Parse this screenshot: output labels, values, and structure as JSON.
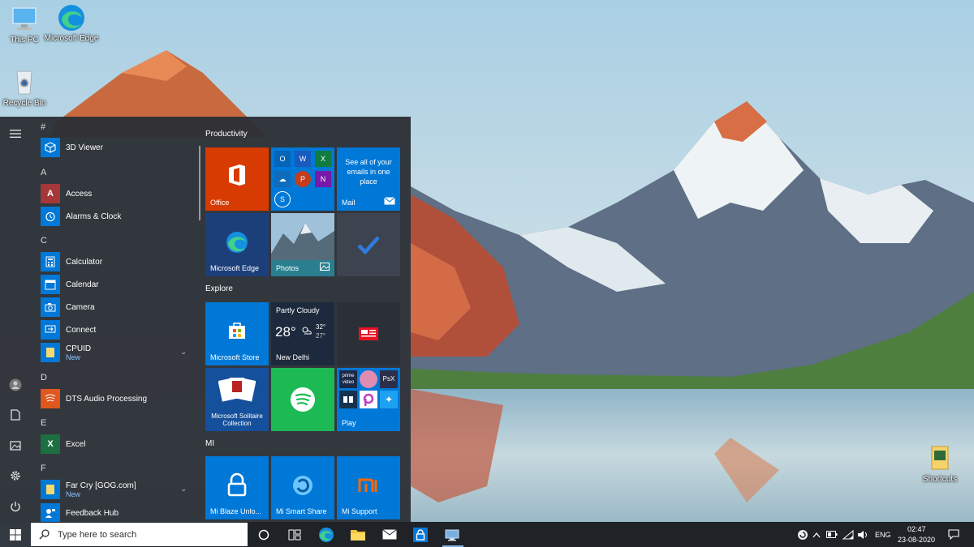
{
  "desktop": {
    "icons": [
      {
        "label": "This PC"
      },
      {
        "label": "Microsoft Edge"
      },
      {
        "label": "Recycle Bin"
      },
      {
        "label": "Shortcuts"
      }
    ]
  },
  "start_menu": {
    "rail": {
      "menu_icon": "hamburger-icon",
      "user_icon": "user-icon",
      "documents_icon": "document-icon",
      "pictures_icon": "pictures-icon",
      "settings_icon": "gear-icon",
      "power_icon": "power-icon"
    },
    "app_list": {
      "groups": {
        "hash": "#",
        "a": "A",
        "c": "C",
        "d": "D",
        "e": "E",
        "f": "F"
      },
      "apps": {
        "viewer3d": "3D Viewer",
        "access": "Access",
        "alarms": "Alarms & Clock",
        "calculator": "Calculator",
        "calendar": "Calendar",
        "camera": "Camera",
        "connect": "Connect",
        "cpuid": "CPUID",
        "cpuid_sub": "New",
        "dts": "DTS Audio Processing",
        "excel": "Excel",
        "farcry": "Far Cry [GOG.com]",
        "farcry_sub": "New",
        "feedback": "Feedback Hub"
      }
    },
    "tiles": {
      "groups": {
        "productivity": "Productivity",
        "explore": "Explore",
        "mi": "MI"
      },
      "office": "Office",
      "mail_text": "See all of your emails in one place",
      "mail": "Mail",
      "edge": "Microsoft Edge",
      "photos": "Photos",
      "store": "Microsoft Store",
      "weather": {
        "condition": "Partly Cloudy",
        "temp": "28°",
        "high": "32°",
        "low": "27°",
        "city": "New Delhi"
      },
      "solitaire": "Microsoft Solitaire Collection",
      "play": "Play",
      "mi_blaze": "Mi Blaze Unlo...",
      "mi_share": "Mi Smart Share",
      "mi_support": "Mi Support"
    }
  },
  "taskbar": {
    "search_placeholder": "Type here to search",
    "language": "ENG",
    "time": "02:47",
    "date": "23-08-2020"
  },
  "colors": {
    "office": "#d83b01",
    "tile_blue": "#0078d7",
    "spotify": "#1db954",
    "start_bg": "#2c3036",
    "taskbar_bg": "#1f2226"
  }
}
